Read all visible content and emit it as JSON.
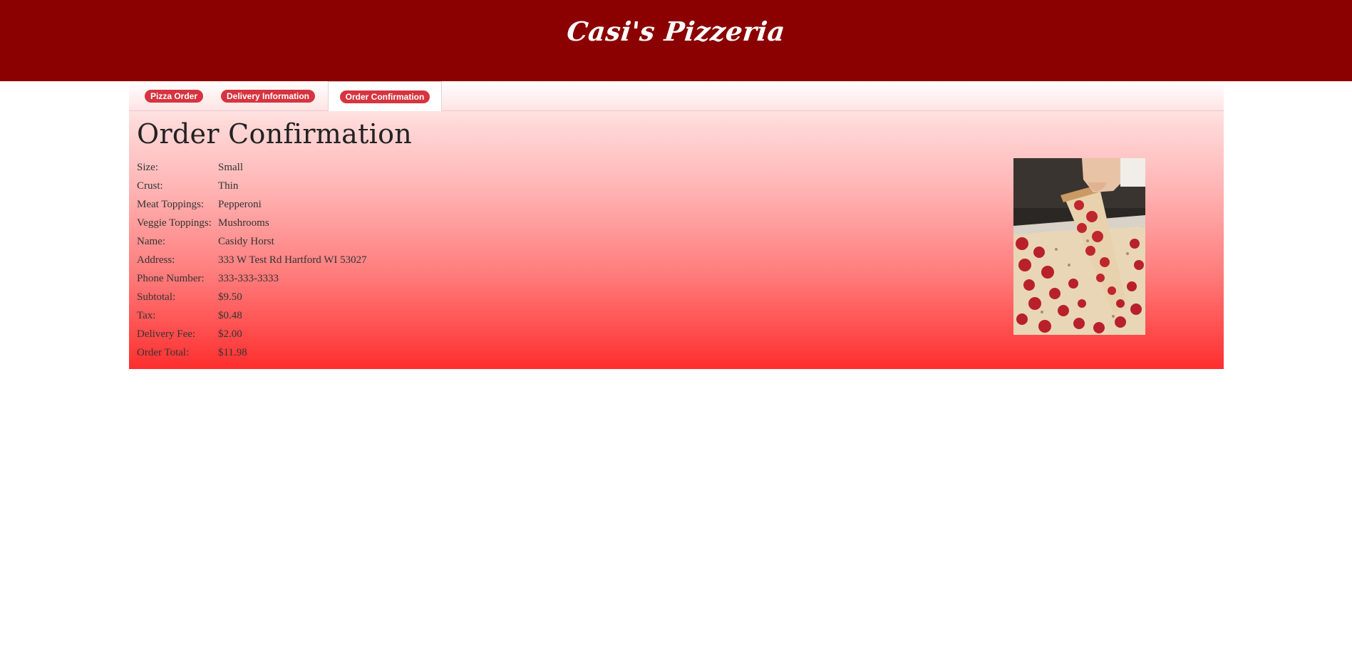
{
  "header": {
    "title": "Casi's Pizzeria"
  },
  "tabs": [
    {
      "label": "Pizza Order",
      "active": false
    },
    {
      "label": "Delivery Information",
      "active": false
    },
    {
      "label": "Order Confirmation",
      "active": true
    }
  ],
  "confirmation": {
    "heading": "Order Confirmation",
    "rows": [
      {
        "label": "Size:",
        "value": "Small"
      },
      {
        "label": "Crust:",
        "value": "Thin"
      },
      {
        "label": "Meat Toppings:",
        "value": "Pepperoni"
      },
      {
        "label": "Veggie Toppings:",
        "value": "Mushrooms"
      },
      {
        "label": "Name:",
        "value": "Casidy Horst"
      },
      {
        "label": "Address:",
        "value": "333 W Test Rd Hartford WI 53027"
      },
      {
        "label": "Phone Number:",
        "value": "333-333-3333"
      },
      {
        "label": "Subtotal:",
        "value": "$9.50"
      },
      {
        "label": "Tax:",
        "value": "$0.48"
      },
      {
        "label": "Delivery Fee:",
        "value": "$2.00"
      },
      {
        "label": "Order Total:",
        "value": "$11.98"
      }
    ]
  },
  "image": {
    "subject": "pepperoni-pizza-photo"
  },
  "colors": {
    "header_bg": "#8b0000",
    "tab_pill": "#d6343f",
    "gradient_top": "#ffffff",
    "gradient_bottom": "#ff2e2e"
  }
}
